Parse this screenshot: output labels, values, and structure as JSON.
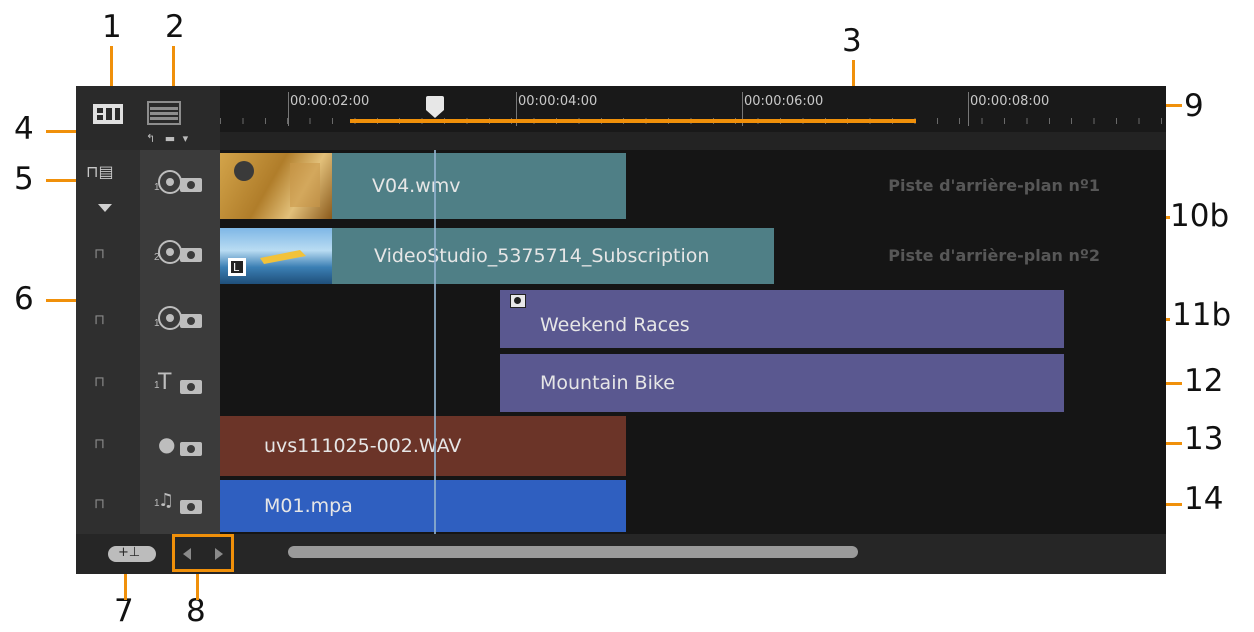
{
  "callouts": [
    "1",
    "2",
    "3",
    "4",
    "5",
    "6",
    "7",
    "8",
    "9",
    "10b",
    "11b",
    "12",
    "13",
    "14"
  ],
  "ruler": {
    "timecodes": [
      "00:00:02:00",
      "00:00:04:00",
      "00:00:06:00",
      "00:00:08:00"
    ]
  },
  "icons": {
    "storyboard": "storyboard-view-icon",
    "timeline": "timeline-view-icon",
    "undo_zoom": "zoom-controls-icon",
    "track_manager": "track-manager-icon",
    "add_track": "add-track-icon",
    "scroll_prev": "scroll-left-icon",
    "scroll_next": "scroll-right-icon"
  },
  "tracks": [
    {
      "type": "video",
      "number": "1",
      "clip": "V04.wmv",
      "background_label": "Piste d'arrière-plan nº1"
    },
    {
      "type": "video",
      "number": "2",
      "clip": "VideoStudio_5375714_Subscription",
      "background_label": "Piste d'arrière-plan nº2"
    },
    {
      "type": "overlay",
      "number": "1",
      "clip": "Weekend Races"
    },
    {
      "type": "title",
      "number": "1",
      "clip": "Mountain Bike"
    },
    {
      "type": "voice",
      "number": "",
      "clip": "uvs111025-002.WAV"
    },
    {
      "type": "music",
      "number": "1",
      "clip": "M01.mpa"
    }
  ],
  "colors": {
    "callout_line": "#f0900a",
    "video_clip": "#4f7f86",
    "overlay_clip": "#5a5890",
    "title_clip": "#5a5890",
    "voice_clip": "#6b3428",
    "music_clip": "#2f5fc0"
  }
}
